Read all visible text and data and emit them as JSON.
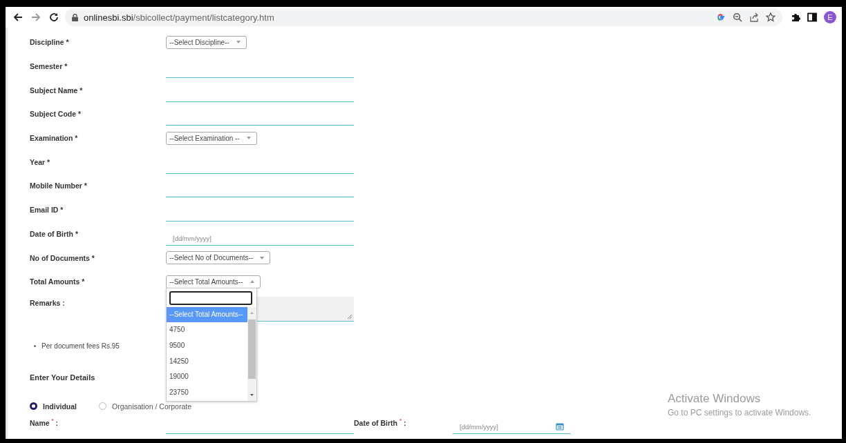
{
  "browser": {
    "url_host": "onlinesbi.sbi",
    "url_path": "/sbicollect/payment/listcategory.htm",
    "profile_initial": "E"
  },
  "fields": [
    {
      "label": "Discipline *",
      "kind": "select",
      "value": "--Select Discipline--",
      "expanded": false
    },
    {
      "label": "Semester *",
      "kind": "text"
    },
    {
      "label": "Subject Name *",
      "kind": "text"
    },
    {
      "label": "Subject Code *",
      "kind": "text"
    },
    {
      "label": "Examination *",
      "kind": "select",
      "value": "--Select Examination --",
      "expanded": false
    },
    {
      "label": "Year *",
      "kind": "text"
    },
    {
      "label": "Mobile Number *",
      "kind": "text"
    },
    {
      "label": "Email ID *",
      "kind": "text"
    },
    {
      "label": "Date of Birth *",
      "kind": "date",
      "placeholder": "[dd/mm/yyyy]"
    },
    {
      "label": "No of Documents *",
      "kind": "select",
      "value": "--Select No of Documents--",
      "expanded": false
    },
    {
      "label": "Total Amounts *",
      "kind": "select",
      "value": "--Select Total Amounts--",
      "expanded": true,
      "options": [
        {
          "label": "--Select Total Amounts--",
          "selected": true
        },
        {
          "label": "4750",
          "selected": false
        },
        {
          "label": "9500",
          "selected": false
        },
        {
          "label": "14250",
          "selected": false
        },
        {
          "label": "19000",
          "selected": false
        },
        {
          "label": "23750",
          "selected": false
        }
      ]
    },
    {
      "label": "Remarks :",
      "kind": "textarea"
    }
  ],
  "notes": [
    "Per document fees Rs.95"
  ],
  "section_title": "Enter Your Details",
  "applicant_types": [
    {
      "label": "Individual",
      "selected": true
    },
    {
      "label": "Organisation / Corporate",
      "selected": false
    }
  ],
  "details_fields": [
    {
      "label": "Name $^{*}$ :",
      "kind": "text"
    },
    {
      "label": "Date of Birth $^{*}$ :",
      "kind": "date",
      "placeholder": "[dd/mm/yyyy]"
    }
  ],
  "os_notice": {
    "title": "Activate Windows",
    "message": "Go to PC settings to activate Windows."
  }
}
